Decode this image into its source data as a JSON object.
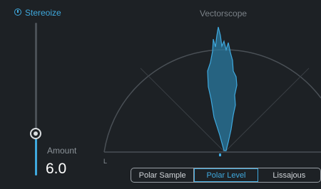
{
  "module": {
    "title": "Stereoize",
    "power_icon": "power-icon"
  },
  "amount": {
    "label": "Amount",
    "value": "6.0",
    "level": 0.27
  },
  "scope": {
    "title": "Vectorscope",
    "left_label": "L"
  },
  "modes": [
    {
      "label": "Polar Sample",
      "active": false
    },
    {
      "label": "Polar Level",
      "active": true
    },
    {
      "label": "Lissajous",
      "active": false
    }
  ],
  "colors": {
    "accent": "#3fa9de",
    "background": "#1d2125"
  }
}
